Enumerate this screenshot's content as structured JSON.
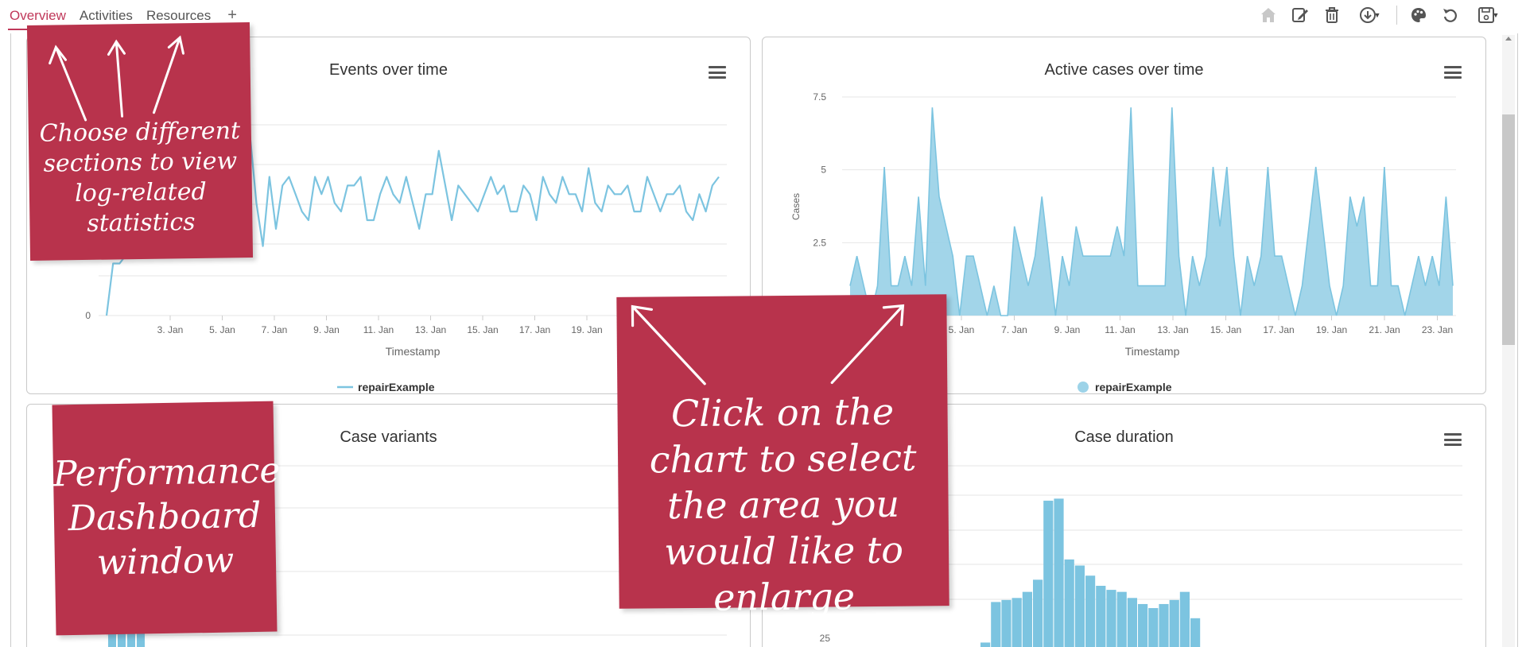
{
  "tabs": [
    {
      "label": "Overview",
      "active": true
    },
    {
      "label": "Activities",
      "active": false
    },
    {
      "label": "Resources",
      "active": false
    }
  ],
  "tab_add_label": "+",
  "toolbar": {
    "icons": [
      "home-icon",
      "edit-icon",
      "trash-icon",
      "download-icon",
      "palette-icon",
      "undo-icon",
      "save-icon"
    ]
  },
  "panels": {
    "events": {
      "title": "Events over time"
    },
    "active_cases": {
      "title": "Active cases over time"
    },
    "case_variants": {
      "title": "Case variants"
    },
    "case_duration": {
      "title": "Case duration"
    }
  },
  "notes": {
    "sections": "Choose different sections to view log-related statistics",
    "dashboard": "Performance Dashboard window",
    "enlarge": "Click on the chart to select the area you would like to enlarge"
  },
  "colors": {
    "accent": "#c0385a",
    "note": "#b8334c",
    "series": "#7cc4e0",
    "series_fill": "#9dd3e8"
  },
  "chart_data": [
    {
      "type": "line",
      "title": "Events over time",
      "xlabel": "Timestamp",
      "ylabel": "",
      "x_ticks": [
        "3. Jan",
        "5. Jan",
        "7. Jan",
        "9. Jan",
        "11. Jan",
        "13. Jan",
        "15. Jan",
        "17. Jan",
        "19. Jan"
      ],
      "y_ticks": [
        "0"
      ],
      "series": [
        {
          "name": "repairExample",
          "values": [
            0,
            30,
            30,
            35,
            40,
            55,
            50,
            70,
            60,
            45,
            45,
            60,
            70,
            85,
            80,
            65,
            60,
            75,
            75,
            85,
            70,
            80,
            105,
            65,
            40,
            80,
            50,
            75,
            80,
            70,
            60,
            55,
            80,
            70,
            80,
            65,
            60,
            75,
            75,
            80,
            55,
            55,
            70,
            80,
            70,
            65,
            80,
            65,
            50,
            70,
            70,
            95,
            75,
            55,
            75,
            70,
            65,
            60,
            70,
            80,
            70,
            75,
            60,
            60,
            75,
            70,
            55,
            80,
            70,
            65,
            80,
            70,
            70,
            60,
            85,
            65,
            60,
            75,
            70,
            70,
            75,
            60,
            60,
            80,
            70,
            60,
            70,
            70,
            75,
            60,
            55,
            70,
            60,
            75,
            80
          ]
        }
      ],
      "legend": "bottom-center",
      "grid": true
    },
    {
      "type": "area",
      "title": "Active cases over time",
      "xlabel": "Timestamp",
      "ylabel": "Cases",
      "x_ticks": [
        "5. Jan",
        "7. Jan",
        "9. Jan",
        "11. Jan",
        "13. Jan",
        "15. Jan",
        "17. Jan",
        "19. Jan",
        "21. Jan",
        "23. Jan"
      ],
      "y_ticks": [
        "0",
        "2.5",
        "5",
        "7.5"
      ],
      "ylim": [
        0,
        7.5
      ],
      "series": [
        {
          "name": "repairExample",
          "values": [
            1,
            2,
            1,
            0,
            1,
            5,
            1,
            1,
            2,
            1,
            4,
            1,
            7,
            4,
            3,
            2,
            0,
            2,
            2,
            1,
            0,
            1,
            0,
            0,
            3,
            2,
            1,
            2,
            4,
            2,
            0,
            2,
            1,
            3,
            2,
            2,
            2,
            2,
            2,
            3,
            2,
            7,
            1,
            1,
            1,
            1,
            1,
            7,
            2,
            0,
            2,
            1,
            2,
            5,
            3,
            5,
            2,
            0,
            2,
            1,
            2,
            5,
            2,
            2,
            1,
            0,
            1,
            3,
            5,
            3,
            1,
            0,
            1,
            4,
            3,
            4,
            1,
            1,
            5,
            1,
            1,
            0,
            1,
            2,
            1,
            2,
            1,
            4,
            1
          ]
        }
      ],
      "legend": "bottom-center",
      "grid": true
    },
    {
      "type": "bar",
      "title": "Case variants",
      "xlabel": "",
      "ylabel": "",
      "categories": [],
      "values": [],
      "grid": true
    },
    {
      "type": "bar",
      "title": "Case duration",
      "xlabel": "",
      "ylabel": "",
      "y_ticks": [
        "25"
      ],
      "values": [
        12,
        32,
        33,
        34,
        37,
        43,
        82,
        83,
        53,
        50,
        45,
        40,
        38,
        37,
        34,
        31,
        29,
        31,
        33,
        37,
        24
      ],
      "grid": true
    }
  ]
}
